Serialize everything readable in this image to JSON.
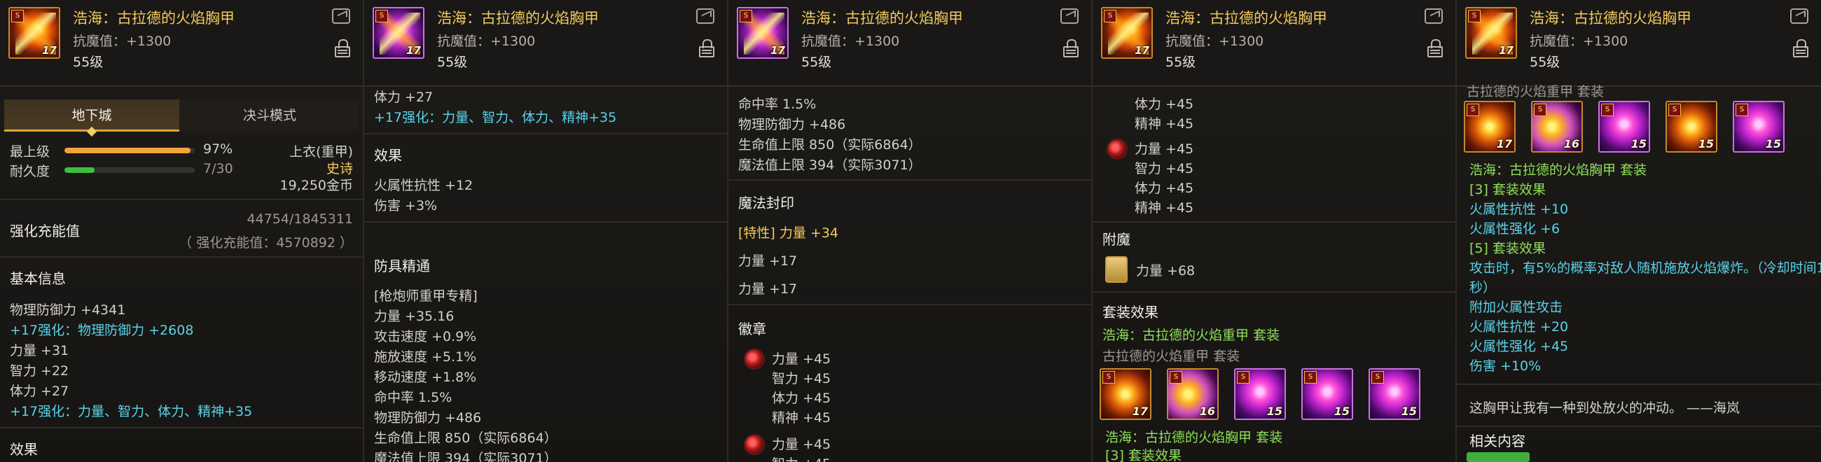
{
  "item": {
    "name": "浩海：古拉德的火焰胸甲",
    "anti_magic": "抗魔值：+1300",
    "level": "55级",
    "thumb_level": "17",
    "thumb_tag": "S"
  },
  "panel1": {
    "tabs": [
      "地下城",
      "决斗模式"
    ],
    "active_tab": "地下城",
    "max_level_label": "最上级",
    "max_level_value": "97%",
    "max_level_fraction": 0.97,
    "durability_label": "耐久度",
    "durability_value": "7/30",
    "durability_fraction": 0.233,
    "slot": "上衣(重甲)",
    "rarity": "史诗",
    "price": "19,250金币",
    "charge_label": "强化充能值",
    "charge_value": "44754/1845311",
    "charge_actual": "（ 强化充能值：4570892 ）",
    "basic_info_title": "基本信息",
    "basic_info": [
      "物理防御力 +4341",
      "+17强化：物理防御力 +2608",
      "力量 +31",
      "智力 +22",
      "体力 +27",
      "+17强化：力量、智力、体力、精神+35"
    ],
    "effect_title": "效果"
  },
  "panel2": {
    "top_lines": [
      "体力 +27",
      "+17强化：力量、智力、体力、精神+35"
    ],
    "effect_title": "效果",
    "effects": [
      "火属性抗性 +12",
      "伤害 +3%"
    ],
    "mastery_title": "防具精通",
    "mastery": [
      "[枪炮师重甲专精]",
      "力量 +35.16",
      "攻击速度 +0.9%",
      "施放速度 +5.1%",
      "移动速度 +1.8%",
      "命中率 1.5%",
      "物理防御力 +486",
      "生命值上限 850（实际6864）",
      "魔法值上限 394（实际3071）"
    ]
  },
  "panel3": {
    "top_lines": [
      "命中率 1.5%",
      "物理防御力 +486",
      "生命值上限 850（实际6864）",
      "魔法值上限 394（实际3071）"
    ],
    "seal_title": "魔法封印",
    "seal_lines": [
      "[特性] 力量 +34",
      "力量 +17",
      "力量 +17"
    ],
    "emblem_title": "徽章",
    "emblem1": [
      "力量 +45",
      "智力 +45",
      "体力 +45",
      "精神 +45"
    ],
    "emblem2": [
      "力量 +45",
      "智力 +45"
    ]
  },
  "panel4": {
    "emblem_top": [
      "体力 +45",
      "精神 +45"
    ],
    "emblem2": [
      "力量 +45",
      "智力 +45",
      "体力 +45",
      "精神 +45"
    ],
    "enchant_title": "附魔",
    "enchant_value": "力量 +68",
    "set_title": "套装效果",
    "set_name": "浩海：古拉德的火焰重甲",
    "set_suffix": "套装",
    "set_base_name": "古拉德的火焰重甲",
    "set_icon_levels": [
      "17",
      "16",
      "15",
      "15",
      "15"
    ],
    "set_name2": "浩海：古拉德的火焰胸甲",
    "set_suffix2": "套装",
    "set3_label": "[3] 套装效果"
  },
  "panel5": {
    "top_text": "古拉德的火焰重甲 套装",
    "set_icon_levels": [
      "17",
      "16",
      "15",
      "15",
      "15"
    ],
    "item_line": "浩海：古拉德的火焰胸甲",
    "item_suffix": "套装",
    "set3_label": "[3] 套装效果",
    "set3": [
      "火属性抗性 +10",
      "火属性强化 +6"
    ],
    "set5_label": "[5] 套装效果",
    "set5_line1": "攻击时，有5%的概率对敌人随机施放火焰爆炸。（冷却时间1",
    "set5_line2": "秒）",
    "set5_rest": [
      "附加火属性攻击",
      "火属性抗性 +20",
      "火属性强化 +45",
      "伤害 +10%"
    ],
    "flavor": "这胸甲让我有一种到处放火的冲动。 ——海岚",
    "related_title": "相关内容"
  },
  "colors": {
    "gold_title": "#f2ca5c",
    "cyan": "#5ad3ea",
    "green": "#8fe05a",
    "bar_orange": "#f0a43a",
    "bar_green": "#3fbf3a"
  }
}
